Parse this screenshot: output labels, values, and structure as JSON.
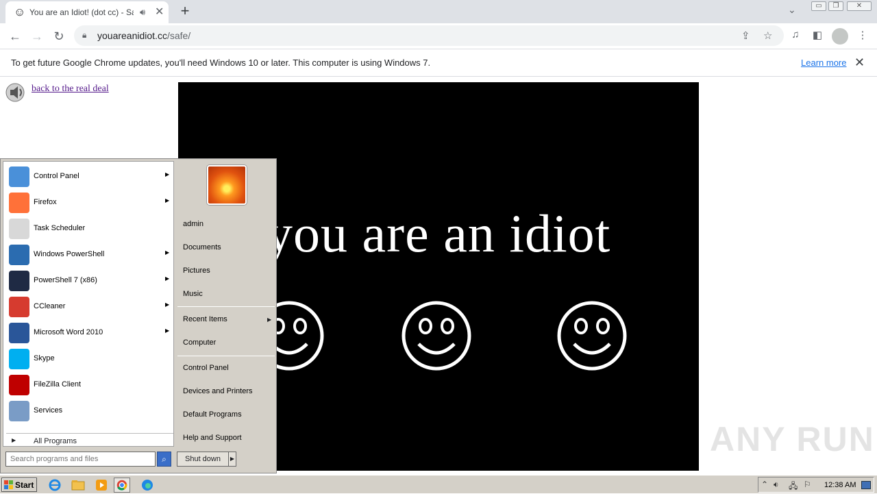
{
  "browser": {
    "tab_title": "You are an Idiot! (dot cc) - Safe",
    "url_host": "youareanidiot.cc",
    "url_path": "/safe/",
    "infobar_message": "To get future Google Chrome updates, you'll need Windows 10 or later. This computer is using Windows 7.",
    "infobar_link": "Learn more"
  },
  "page": {
    "back_link": "back to the real deal",
    "video_text": "you are an idiot"
  },
  "start_menu": {
    "programs": [
      {
        "label": "Control Panel",
        "arrow": true,
        "color": "#4a90d9"
      },
      {
        "label": "Firefox",
        "arrow": true,
        "color": "#ff7139"
      },
      {
        "label": "Task Scheduler",
        "arrow": false,
        "color": "#d8d8d8"
      },
      {
        "label": "Windows PowerShell",
        "arrow": true,
        "color": "#2b6cb0"
      },
      {
        "label": "PowerShell 7 (x86)",
        "arrow": true,
        "color": "#1f2a44"
      },
      {
        "label": "CCleaner",
        "arrow": true,
        "color": "#d63b2f"
      },
      {
        "label": "Microsoft Word 2010",
        "arrow": true,
        "color": "#2a5699"
      },
      {
        "label": "Skype",
        "arrow": false,
        "color": "#00aff0"
      },
      {
        "label": "FileZilla Client",
        "arrow": false,
        "color": "#bf0000"
      },
      {
        "label": "Services",
        "arrow": false,
        "color": "#7a9cc6"
      }
    ],
    "all_programs": "All Programs",
    "search_placeholder": "Search programs and files",
    "right_items": [
      "admin",
      "Documents",
      "Pictures",
      "Music",
      "Recent Items",
      "Computer",
      "Control Panel",
      "Devices and Printers",
      "Default Programs",
      "Help and Support"
    ],
    "shutdown": "Shut down"
  },
  "taskbar": {
    "start": "Start",
    "clock": "12:38 AM"
  },
  "watermark": "ANY RUN"
}
